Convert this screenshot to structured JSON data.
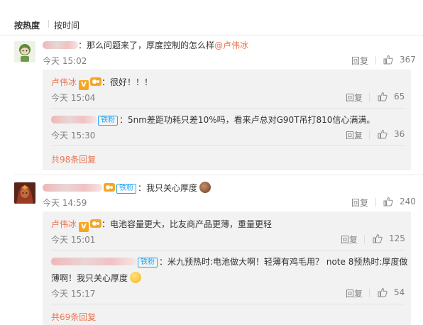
{
  "sort": {
    "hot": "按热度",
    "time": "按时间"
  },
  "comments": [
    {
      "text": "：那么问题来了，厚度控制的怎么样",
      "mention": "@卢伟冰",
      "time": "今天 15:02",
      "reply": "回复",
      "likes": "367",
      "subs": [
        {
          "user": "卢伟冰",
          "v": "V",
          "text": "：很好！！！",
          "time": "今天 15:04",
          "reply": "回复",
          "likes": "65"
        },
        {
          "fan": "铁粉",
          "text": "：5nm差距功耗只差10%吗，看来卢总对G90T吊打810信心满满。",
          "time": "今天 15:30",
          "reply": "回复",
          "likes": "36"
        }
      ],
      "more": "共98条回复"
    },
    {
      "fan": "铁粉",
      "text": "：我只关心厚度",
      "time": "今天 14:59",
      "reply": "回复",
      "likes": "240",
      "subs": [
        {
          "user": "卢伟冰",
          "v": "V",
          "text": "：电池容量更大，比友商产品更薄，重量更轻",
          "time": "今天 15:01",
          "reply": "回复",
          "likes": "125"
        },
        {
          "fan": "铁粉",
          "text1": "：米九预热时:电池做大啊！轻薄有鸡毛用？ note 8预热时:厚度做",
          "text2": "薄啊！我只关心厚度",
          "time": "今天 15:17",
          "reply": "回复",
          "likes": "54"
        }
      ],
      "more": "共69条回复"
    }
  ],
  "colors": {
    "accent": "#eb7350",
    "fan_badge": "#27a7f1",
    "muted": "#808080"
  }
}
